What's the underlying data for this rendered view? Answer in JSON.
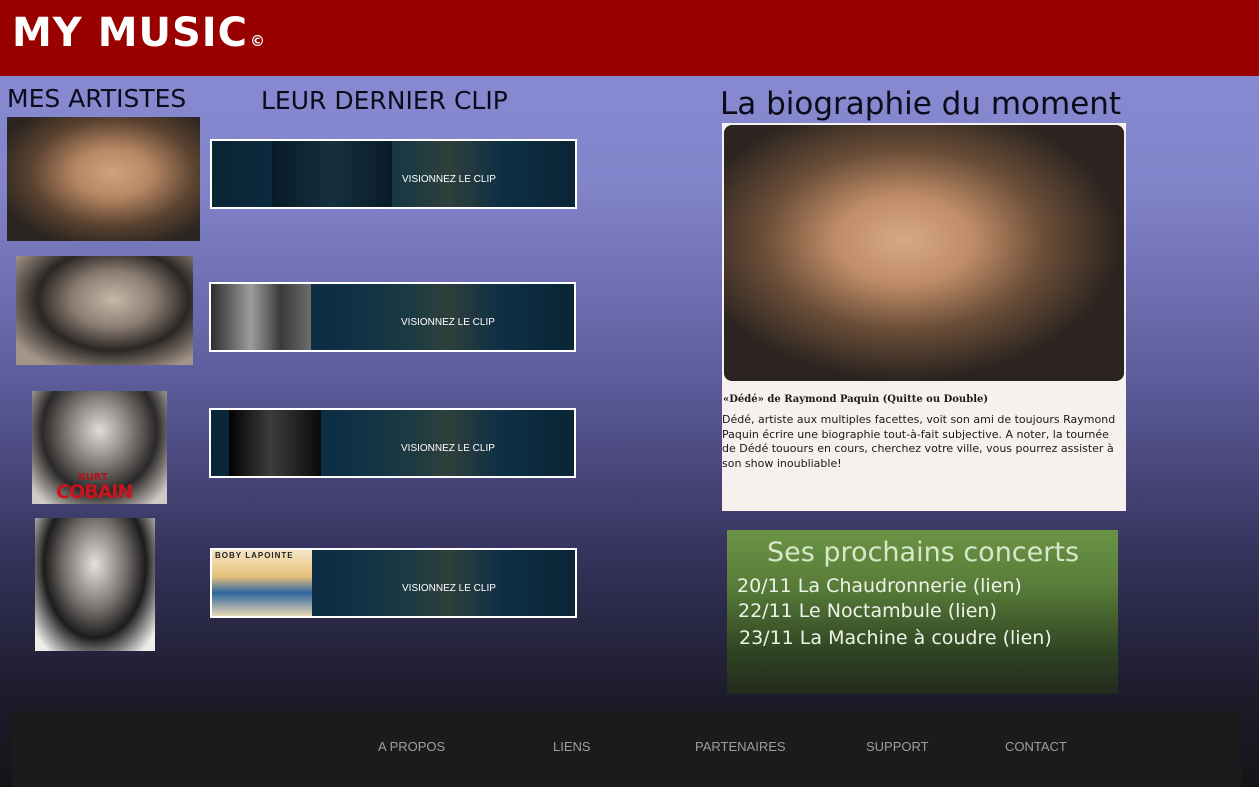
{
  "header": {
    "logo": "MY MUSIC",
    "logo_mark": "©"
  },
  "sections": {
    "artists_title": "MES ARTISTES",
    "clips_title": "LEUR DERNIER CLIP",
    "bio_title": "La biographie du moment"
  },
  "artists": [
    {
      "photo_text": ""
    },
    {
      "photo_text": ""
    },
    {
      "photo_text": "COBAIN",
      "photo_text_small": "KURT"
    },
    {
      "photo_text": ""
    }
  ],
  "clips": [
    {
      "label": "VISIONNEZ LE CLIP"
    },
    {
      "label": "VISIONNEZ LE CLIP"
    },
    {
      "label": "VISIONNEZ LE CLIP"
    },
    {
      "label": "VISIONNEZ LE CLIP",
      "thumb_text": "BOBY LAPOINTE"
    }
  ],
  "bio": {
    "caption": "«Dédé» de Raymond Paquin (Quitte ou Double)",
    "text": "Dédé, artiste aux multiples facettes, voit son ami de toujours Raymond Paquin écrire une biographie tout-à-fait subjective. A noter, la tournée de Dédé touours en cours, cherchez votre ville, vous pourrez assister à son show inoubliable!"
  },
  "concerts": {
    "title": "Ses prochains concerts",
    "items": [
      "20/11 La Chaudronnerie (lien)",
      "22/11 Le Noctambule (lien)",
      "23/11 La Machine à coudre (lien)"
    ]
  },
  "footer": {
    "links": [
      "A PROPOS",
      "LIENS",
      "PARTENAIRES",
      "SUPPORT",
      "CONTACT"
    ]
  },
  "colors": {
    "header_bg": "#990000",
    "footer_bg": "#1b1b1b",
    "concerts_bg": "#577c39"
  }
}
